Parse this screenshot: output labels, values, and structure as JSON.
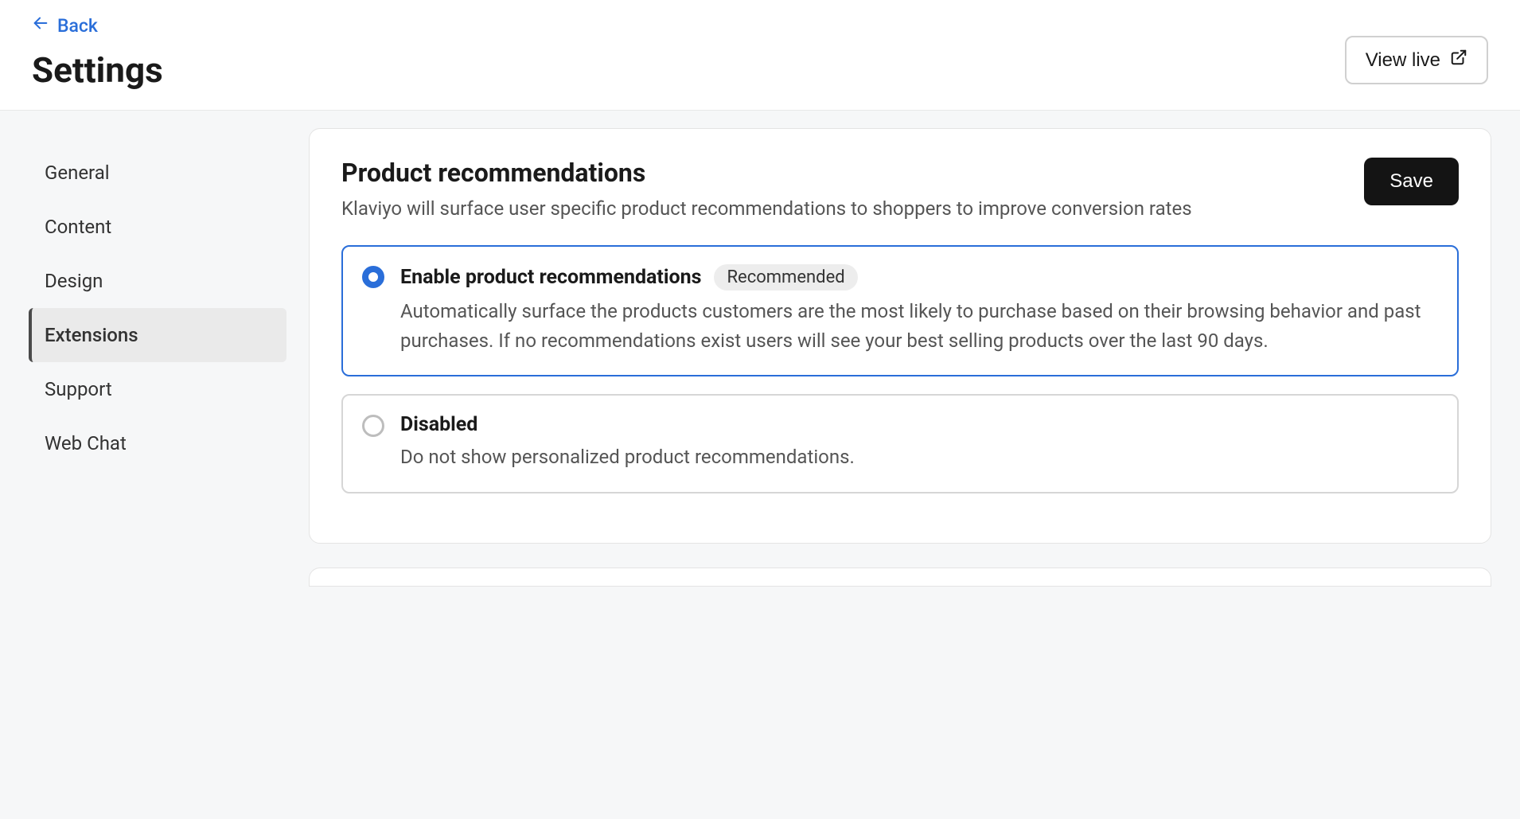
{
  "header": {
    "back_label": "Back",
    "title": "Settings",
    "view_live_label": "View live"
  },
  "sidebar": {
    "items": [
      {
        "label": "General",
        "active": false
      },
      {
        "label": "Content",
        "active": false
      },
      {
        "label": "Design",
        "active": false
      },
      {
        "label": "Extensions",
        "active": true
      },
      {
        "label": "Support",
        "active": false
      },
      {
        "label": "Web Chat",
        "active": false
      }
    ]
  },
  "card": {
    "title": "Product recommendations",
    "subtitle": "Klaviyo will surface user specific product recommendations to shoppers to improve conversion rates",
    "save_label": "Save",
    "options": [
      {
        "title": "Enable product recommendations",
        "badge": "Recommended",
        "description": "Automatically surface the products customers are the most likely to purchase based on their browsing behavior and past purchases. If no recommendations exist users will see your best selling products over the last 90 days.",
        "selected": true
      },
      {
        "title": "Disabled",
        "badge": "",
        "description": "Do not show personalized product recommendations.",
        "selected": false
      }
    ]
  }
}
